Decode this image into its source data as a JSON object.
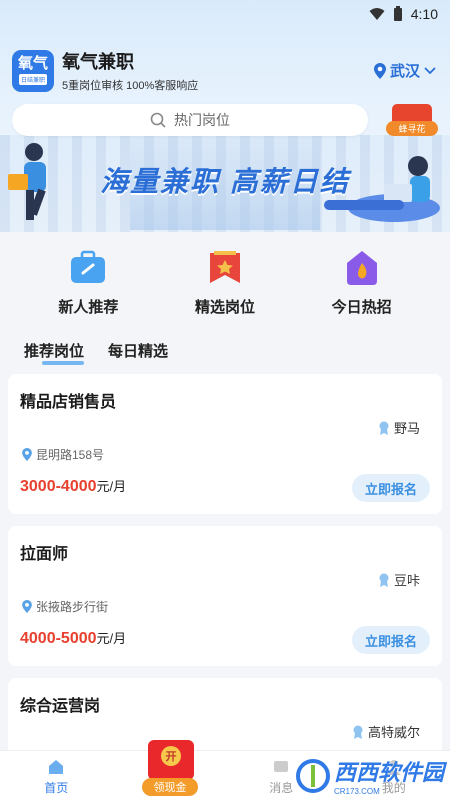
{
  "status_bar": {
    "time": "4:10"
  },
  "app": {
    "logo_text": "氧气",
    "logo_sub": "日结兼职",
    "title": "氧气兼职",
    "subtitle": "5重岗位审核 100%客服响应"
  },
  "location": {
    "city": "武汉"
  },
  "search": {
    "placeholder": "热门岗位"
  },
  "promo_badge": {
    "label": "蜂寻花"
  },
  "banner": {
    "slogan": "海量兼职 高薪日结"
  },
  "categories": [
    {
      "label": "新人推荐",
      "icon": "briefcase-icon",
      "color": "#4aa3f0"
    },
    {
      "label": "精选岗位",
      "icon": "ribbon-icon",
      "color": "#e8453c"
    },
    {
      "label": "今日热招",
      "icon": "flame-icon",
      "color": "#8a5be8"
    }
  ],
  "tabs": [
    {
      "label": "推荐岗位"
    },
    {
      "label": "每日精选"
    }
  ],
  "jobs": [
    {
      "title": "精品店销售员",
      "company": "野马",
      "address": "昆明路158号",
      "salary": "3000-4000",
      "unit": "元/月",
      "apply": "立即报名"
    },
    {
      "title": "拉面师",
      "company": "豆咔",
      "address": "张掖路步行街",
      "salary": "4000-5000",
      "unit": "元/月",
      "apply": "立即报名"
    },
    {
      "title": "综合运营岗",
      "company": "高特威尔"
    }
  ],
  "bottom_nav": [
    {
      "label": "首页"
    },
    {
      "label": "消息"
    },
    {
      "label": "我的"
    }
  ],
  "reward": {
    "coin": "开",
    "label": "领现金"
  },
  "watermark": {
    "text": "西西软件园",
    "sub": "CR173.COM"
  },
  "colors": {
    "accent": "#2f7ae6",
    "salary": "#e8402f",
    "apply_bg": "#e3f0fc"
  }
}
